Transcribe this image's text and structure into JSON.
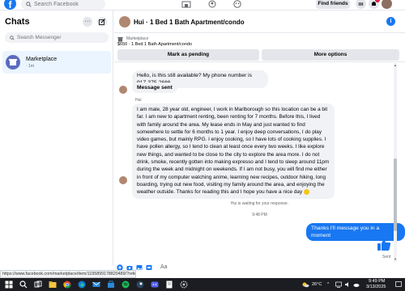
{
  "topbar": {
    "search_placeholder": "Search Facebook",
    "find_friends": "Find friends"
  },
  "sidebar": {
    "title": "Chats",
    "search_placeholder": "Search Messenger",
    "chat": {
      "name": "Marketplace",
      "time": "· 1m"
    }
  },
  "conversation": {
    "title": "Hui · 1 Bed 1 Bath Apartment/condo",
    "info_icon": "i"
  },
  "marketplace_banner": {
    "label": "Marketplace",
    "listing": "$650 · 1 Bed 1 Bath Apartment/condo",
    "mark_pending": "Mark as pending",
    "more_options": "More options"
  },
  "messages": {
    "m1": "Hello, is this still available? My phone number is 917-375-2666",
    "m2": "Message sent",
    "sender": "Hui",
    "m3": "I am male, 28 year old, engineer, I work in Marlborough so this location can be a bit far. I am new to apartment renting, been renting for 7 months. Before this, I lived with family around the area. My lease ends in May and just wanted to find somewhere to settle for 6 months to 1 year. I enjoy deep conversations, I do play video games, but mainly RPG. I enjoy cooking, so I have lots of cooking supplies. I have pollen allergy, so I tend to clean at least once every two weeks. I like explore new things, and wanted to be close to the city to explore the area more. I do not drink, smoke, recently gotten into making expresso and I tend to sleep around 11pm during the week and midnight on weekends. If I am not busy, you will find me either in front of my computer watching anime, learning new recipes, outdoor hiking, long boarding, trying out new food, visiting my family around the area, and enjoying the weather outside. Thanks for reading this and I hope you have a nice day",
    "waiting": "Hui is waiting for your response.",
    "time": "9:48 PM",
    "reply": "Thanks I'll message you in a moment",
    "sent": "Sent"
  },
  "composer": {
    "aa": "Aa"
  },
  "status_url": "https://www.facebook.com/marketplace/item/1195899178820489/?referralS...",
  "taskbar": {
    "temp": "26°C",
    "time": "9:49 PM",
    "date": "3/13/2025"
  },
  "colors": {
    "brand": "#1877f2",
    "bubble_in": "#f0f2f5",
    "badge": "#e41e3f"
  }
}
